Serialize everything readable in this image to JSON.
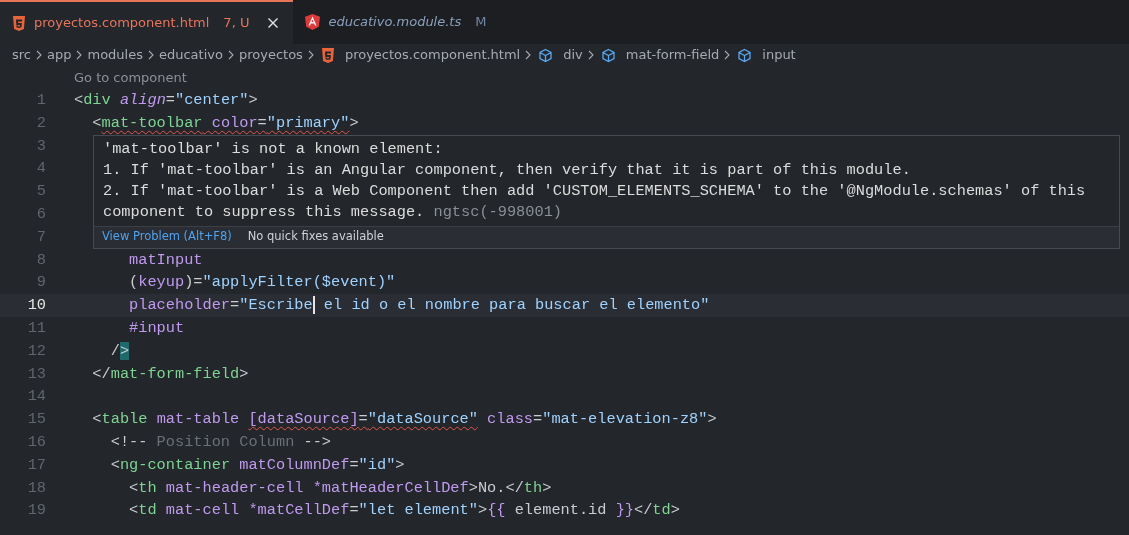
{
  "tabs": [
    {
      "label": "proyectos.component.html",
      "kind": "html",
      "decoration": "7, U",
      "selected": true,
      "italic": false,
      "closable": true
    },
    {
      "label": "educativo.module.ts",
      "kind": "angular",
      "decoration": "M",
      "selected": false,
      "italic": true,
      "closable": false
    }
  ],
  "breadcrumb": [
    {
      "label": "src",
      "kind": "folder"
    },
    {
      "label": "app",
      "kind": "folder"
    },
    {
      "label": "modules",
      "kind": "folder"
    },
    {
      "label": "educativo",
      "kind": "folder"
    },
    {
      "label": "proyectos",
      "kind": "folder"
    },
    {
      "label": "proyectos.component.html",
      "kind": "html"
    },
    {
      "label": "div",
      "kind": "element"
    },
    {
      "label": "mat-form-field",
      "kind": "element"
    },
    {
      "label": "input",
      "kind": "element"
    }
  ],
  "codelens": "Go to component",
  "lines": [
    {
      "number": "1",
      "current": false,
      "tokens": [
        {
          "text": "<",
          "kind": "punct"
        },
        {
          "text": "div",
          "kind": "tag"
        },
        {
          "text": " align",
          "kind": "attr-italic"
        },
        {
          "text": "=",
          "kind": "punct"
        },
        {
          "text": "\"center\"",
          "kind": "string"
        },
        {
          "text": ">",
          "kind": "punct"
        }
      ]
    },
    {
      "number": "2",
      "current": false,
      "tokens": [
        {
          "text": "  <",
          "kind": "punct"
        },
        {
          "text": "mat-toolbar",
          "kind": "tag-error"
        },
        {
          "text": " color",
          "kind": "attr-error"
        },
        {
          "text": "=",
          "kind": "punct-error"
        },
        {
          "text": "\"primary\"",
          "kind": "string-error"
        },
        {
          "text": ">",
          "kind": "punct"
        }
      ]
    },
    {
      "number": "3",
      "current": false
    },
    {
      "number": "4",
      "current": false
    },
    {
      "number": "5",
      "current": false
    },
    {
      "number": "6",
      "current": false
    },
    {
      "number": "7",
      "current": false
    },
    {
      "number": "8",
      "current": false,
      "tokens": [
        {
          "text": "      matInput",
          "kind": "attr"
        }
      ]
    },
    {
      "number": "9",
      "current": false,
      "tokens": [
        {
          "text": "      (",
          "kind": "punct"
        },
        {
          "text": "keyup",
          "kind": "attr"
        },
        {
          "text": ")=",
          "kind": "punct"
        },
        {
          "text": "\"applyFilter($event)\"",
          "kind": "string"
        }
      ]
    },
    {
      "number": "10",
      "current": true,
      "tokens": [
        {
          "text": "      placeholder",
          "kind": "attr"
        },
        {
          "text": "=",
          "kind": "punct"
        },
        {
          "text": "\"Escribe",
          "kind": "string-caret"
        },
        {
          "text": " el id o el nombre para buscar el elemento\"",
          "kind": "string"
        }
      ]
    },
    {
      "number": "11",
      "current": false,
      "tokens": [
        {
          "text": "      #input",
          "kind": "attr"
        }
      ]
    },
    {
      "number": "12",
      "current": false,
      "tokens": [
        {
          "text": "    /",
          "kind": "punct"
        },
        {
          "text": ">",
          "kind": "punct-matched"
        }
      ]
    },
    {
      "number": "13",
      "current": false,
      "tokens": [
        {
          "text": "  </",
          "kind": "punct"
        },
        {
          "text": "mat-form-field",
          "kind": "tag"
        },
        {
          "text": ">",
          "kind": "punct"
        }
      ]
    },
    {
      "number": "14",
      "current": false
    },
    {
      "number": "15",
      "current": false,
      "tokens": [
        {
          "text": "  <",
          "kind": "punct"
        },
        {
          "text": "table",
          "kind": "tag"
        },
        {
          "text": " mat-table ",
          "kind": "attr"
        },
        {
          "text": "[dataSource]",
          "kind": "attr-error"
        },
        {
          "text": "=",
          "kind": "punct-error"
        },
        {
          "text": "\"dataSource\"",
          "kind": "string-error"
        },
        {
          "text": " class",
          "kind": "attr"
        },
        {
          "text": "=",
          "kind": "punct"
        },
        {
          "text": "\"mat-elevation-z8\"",
          "kind": "string"
        },
        {
          "text": ">",
          "kind": "punct"
        }
      ]
    },
    {
      "number": "16",
      "current": false,
      "tokens": [
        {
          "text": "    <!--",
          "kind": "punct"
        },
        {
          "text": " Position Column",
          "kind": "comment"
        },
        {
          "text": " -->",
          "kind": "punct"
        }
      ]
    },
    {
      "number": "17",
      "current": false,
      "tokens": [
        {
          "text": "    <",
          "kind": "punct"
        },
        {
          "text": "ng-container",
          "kind": "tag"
        },
        {
          "text": " matColumnDef",
          "kind": "attr"
        },
        {
          "text": "=",
          "kind": "punct"
        },
        {
          "text": "\"id\"",
          "kind": "string"
        },
        {
          "text": ">",
          "kind": "punct"
        }
      ]
    },
    {
      "number": "18",
      "current": false,
      "tokens": [
        {
          "text": "      <",
          "kind": "punct"
        },
        {
          "text": "th",
          "kind": "tag"
        },
        {
          "text": " mat-header-cell",
          "kind": "attr"
        },
        {
          "text": " *matHeaderCellDef",
          "kind": "attr"
        },
        {
          "text": ">No.</",
          "kind": "punct"
        },
        {
          "text": "th",
          "kind": "tag"
        },
        {
          "text": ">",
          "kind": "punct"
        }
      ]
    },
    {
      "number": "19",
      "current": false,
      "tokens": [
        {
          "text": "      <",
          "kind": "punct"
        },
        {
          "text": "td",
          "kind": "tag"
        },
        {
          "text": " mat-cell",
          "kind": "attr"
        },
        {
          "text": " *matCellDef",
          "kind": "attr"
        },
        {
          "text": "=",
          "kind": "punct"
        },
        {
          "text": "\"let element\"",
          "kind": "string"
        },
        {
          "text": ">",
          "kind": "punct"
        },
        {
          "text": "{{",
          "kind": "brace"
        },
        {
          "text": " element.id ",
          "kind": "punct"
        },
        {
          "text": "}}",
          "kind": "brace"
        },
        {
          "text": "</",
          "kind": "punct"
        },
        {
          "text": "td",
          "kind": "tag"
        },
        {
          "text": ">",
          "kind": "punct"
        }
      ]
    }
  ],
  "hover": {
    "message_lines": [
      "'mat-toolbar' is not a known element:",
      "1. If 'mat-toolbar' is an Angular component, then verify that it is part of this module.",
      "2. If 'mat-toolbar' is a Web Component then add 'CUSTOM_ELEMENTS_SCHEMA' to the '@NgModule.schemas' of this",
      "component to suppress this message."
    ],
    "code": "ngtsc(-998001)",
    "action": "View Problem (Alt+F8)",
    "note": "No quick fixes available"
  }
}
